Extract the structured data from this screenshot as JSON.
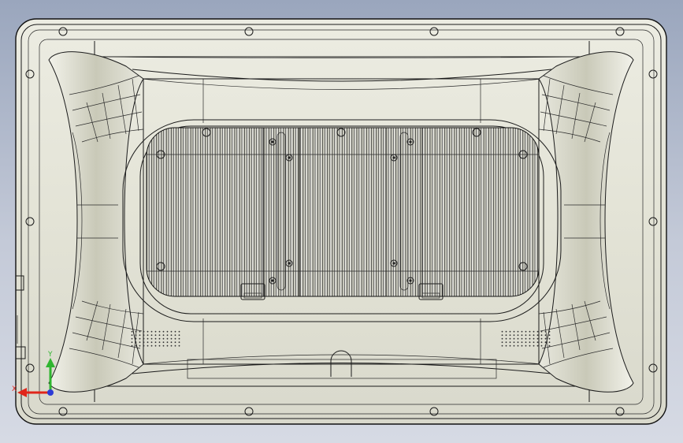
{
  "viewport": {
    "background_top": "#9aa6bd",
    "background_bottom": "#d6dae4",
    "part_color": "#e4e4d8",
    "edge_color": "#1b1b1b"
  },
  "model": {
    "description_icons": [
      "mounting-hole-icon",
      "heatsink-fin-icon",
      "speaker-grille-icon",
      "clip-icon"
    ]
  },
  "triad": {
    "x_label": "X",
    "y_label": "Y",
    "x_color": "#e0261b",
    "y_color": "#2fb52f",
    "z_color": "#2c3bd6"
  }
}
